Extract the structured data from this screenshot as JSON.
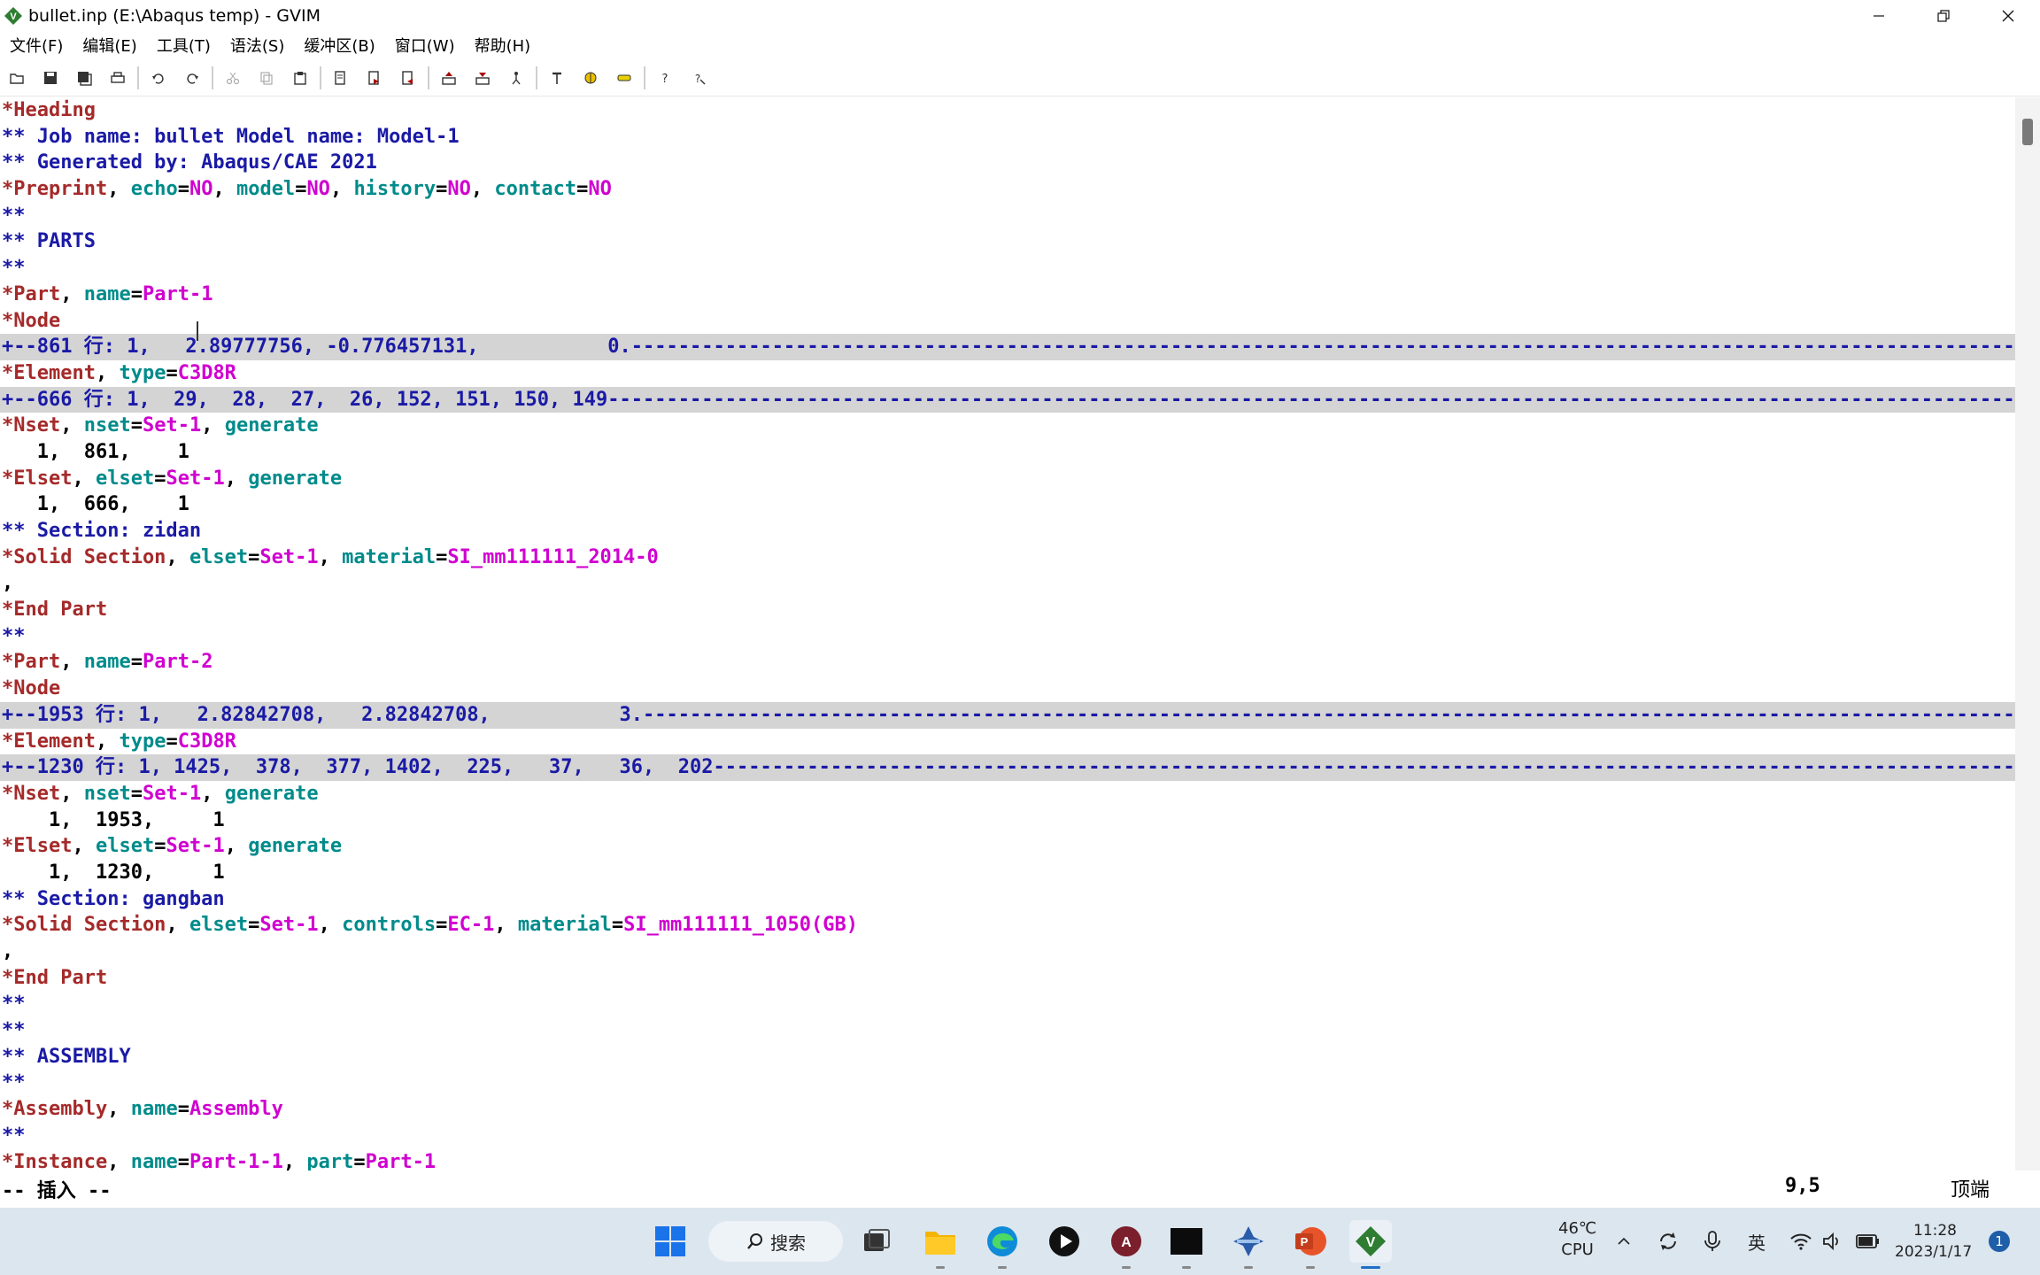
{
  "window": {
    "title": "bullet.inp (E:\\Abaqus temp) - GVIM"
  },
  "menu": [
    "文件(F)",
    "编辑(E)",
    "工具(T)",
    "语法(S)",
    "缓冲区(B)",
    "窗口(W)",
    "帮助(H)"
  ],
  "toolbar": {
    "groups": [
      [
        "open-icon",
        "save-icon",
        "save-all-icon",
        "print-icon"
      ],
      [
        "undo-icon",
        "redo-icon"
      ],
      [
        "cut-icon",
        "copy-icon",
        "paste-icon"
      ],
      [
        "find-replace-icon",
        "find-next-icon",
        "find-prev-icon"
      ],
      [
        "load-session-icon",
        "save-session-icon",
        "run-script-icon"
      ],
      [
        "make-icon",
        "shell-icon",
        "tags-icon"
      ],
      [
        "help-icon",
        "find-help-icon"
      ]
    ]
  },
  "editor": {
    "lines": [
      [
        {
          "t": "*Heading",
          "c": "kw"
        }
      ],
      [
        {
          "t": "** Job name: bullet Model name: Model-1",
          "c": "cmt"
        }
      ],
      [
        {
          "t": "** Generated by: Abaqus/CAE 2021",
          "c": "cmt"
        }
      ],
      [
        {
          "t": "*Preprint",
          "c": "kw"
        },
        {
          "t": ", ",
          "c": "plain"
        },
        {
          "t": "echo",
          "c": "attr"
        },
        {
          "t": "=",
          "c": "plain"
        },
        {
          "t": "NO",
          "c": "val"
        },
        {
          "t": ", ",
          "c": "plain"
        },
        {
          "t": "model",
          "c": "attr"
        },
        {
          "t": "=",
          "c": "plain"
        },
        {
          "t": "NO",
          "c": "val"
        },
        {
          "t": ", ",
          "c": "plain"
        },
        {
          "t": "history",
          "c": "attr"
        },
        {
          "t": "=",
          "c": "plain"
        },
        {
          "t": "NO",
          "c": "val"
        },
        {
          "t": ", ",
          "c": "plain"
        },
        {
          "t": "contact",
          "c": "attr"
        },
        {
          "t": "=",
          "c": "plain"
        },
        {
          "t": "NO",
          "c": "val"
        }
      ],
      [
        {
          "t": "**",
          "c": "cmt"
        }
      ],
      [
        {
          "t": "** PARTS",
          "c": "cmt"
        }
      ],
      [
        {
          "t": "**",
          "c": "cmt"
        }
      ],
      [
        {
          "t": "*Part",
          "c": "kw"
        },
        {
          "t": ", ",
          "c": "plain"
        },
        {
          "t": "name",
          "c": "attr"
        },
        {
          "t": "=",
          "c": "plain"
        },
        {
          "t": "Part-1",
          "c": "val"
        }
      ],
      [
        {
          "t": "*Node",
          "c": "kw"
        }
      ],
      {
        "fold": "+--861 行: 1,   2.89777756, -0.776457131,           0.------------------------------------------------------------------------------------------------------------------------------------------"
      },
      [
        {
          "t": "*Element",
          "c": "kw"
        },
        {
          "t": ", ",
          "c": "plain"
        },
        {
          "t": "type",
          "c": "attr"
        },
        {
          "t": "=",
          "c": "plain"
        },
        {
          "t": "C3D8R",
          "c": "val"
        }
      ],
      {
        "fold": "+--666 行: 1,  29,  28,  27,  26, 152, 151, 150, 149--------------------------------------------------------------------------------------------------------------------------------------------------"
      },
      [
        {
          "t": "*Nset",
          "c": "kw"
        },
        {
          "t": ", ",
          "c": "plain"
        },
        {
          "t": "nset",
          "c": "attr"
        },
        {
          "t": "=",
          "c": "plain"
        },
        {
          "t": "Set-1",
          "c": "val"
        },
        {
          "t": ", ",
          "c": "plain"
        },
        {
          "t": "generate",
          "c": "attr"
        }
      ],
      [
        {
          "t": "   1,  861,    1",
          "c": "plain"
        }
      ],
      [
        {
          "t": "*Elset",
          "c": "kw"
        },
        {
          "t": ", ",
          "c": "plain"
        },
        {
          "t": "elset",
          "c": "attr"
        },
        {
          "t": "=",
          "c": "plain"
        },
        {
          "t": "Set-1",
          "c": "val"
        },
        {
          "t": ", ",
          "c": "plain"
        },
        {
          "t": "generate",
          "c": "attr"
        }
      ],
      [
        {
          "t": "   1,  666,    1",
          "c": "plain"
        }
      ],
      [
        {
          "t": "** Section: zidan",
          "c": "cmt"
        }
      ],
      [
        {
          "t": "*Solid Section",
          "c": "kw"
        },
        {
          "t": ", ",
          "c": "plain"
        },
        {
          "t": "elset",
          "c": "attr"
        },
        {
          "t": "=",
          "c": "plain"
        },
        {
          "t": "Set-1",
          "c": "val"
        },
        {
          "t": ", ",
          "c": "plain"
        },
        {
          "t": "material",
          "c": "attr"
        },
        {
          "t": "=",
          "c": "plain"
        },
        {
          "t": "SI_mm111111_2014-0",
          "c": "val"
        }
      ],
      [
        {
          "t": ",",
          "c": "plain"
        }
      ],
      [
        {
          "t": "*End Part",
          "c": "kw"
        }
      ],
      [
        {
          "t": "**",
          "c": "cmt"
        }
      ],
      [
        {
          "t": "*Part",
          "c": "kw"
        },
        {
          "t": ", ",
          "c": "plain"
        },
        {
          "t": "name",
          "c": "attr"
        },
        {
          "t": "=",
          "c": "plain"
        },
        {
          "t": "Part-2",
          "c": "val"
        }
      ],
      [
        {
          "t": "*Node",
          "c": "kw"
        }
      ],
      {
        "fold": "+--1953 行: 1,   2.82842708,   2.82842708,           3.----------------------------------------------------------------------------------------------------------------------------------------"
      },
      [
        {
          "t": "*Element",
          "c": "kw"
        },
        {
          "t": ", ",
          "c": "plain"
        },
        {
          "t": "type",
          "c": "attr"
        },
        {
          "t": "=",
          "c": "plain"
        },
        {
          "t": "C3D8R",
          "c": "val"
        }
      ],
      {
        "fold": "+--1230 行: 1, 1425,  378,  377, 1402,  225,   37,   36,  202-------------------------------------------------------------------------------------------------------------------------------------------"
      },
      [
        {
          "t": "*Nset",
          "c": "kw"
        },
        {
          "t": ", ",
          "c": "plain"
        },
        {
          "t": "nset",
          "c": "attr"
        },
        {
          "t": "=",
          "c": "plain"
        },
        {
          "t": "Set-1",
          "c": "val"
        },
        {
          "t": ", ",
          "c": "plain"
        },
        {
          "t": "generate",
          "c": "attr"
        }
      ],
      [
        {
          "t": "    1,  1953,     1",
          "c": "plain"
        }
      ],
      [
        {
          "t": "*Elset",
          "c": "kw"
        },
        {
          "t": ", ",
          "c": "plain"
        },
        {
          "t": "elset",
          "c": "attr"
        },
        {
          "t": "=",
          "c": "plain"
        },
        {
          "t": "Set-1",
          "c": "val"
        },
        {
          "t": ", ",
          "c": "plain"
        },
        {
          "t": "generate",
          "c": "attr"
        }
      ],
      [
        {
          "t": "    1,  1230,     1",
          "c": "plain"
        }
      ],
      [
        {
          "t": "** Section: gangban",
          "c": "cmt"
        }
      ],
      [
        {
          "t": "*Solid Section",
          "c": "kw"
        },
        {
          "t": ", ",
          "c": "plain"
        },
        {
          "t": "elset",
          "c": "attr"
        },
        {
          "t": "=",
          "c": "plain"
        },
        {
          "t": "Set-1",
          "c": "val"
        },
        {
          "t": ", ",
          "c": "plain"
        },
        {
          "t": "controls",
          "c": "attr"
        },
        {
          "t": "=",
          "c": "plain"
        },
        {
          "t": "EC-1",
          "c": "val"
        },
        {
          "t": ", ",
          "c": "plain"
        },
        {
          "t": "material",
          "c": "attr"
        },
        {
          "t": "=",
          "c": "plain"
        },
        {
          "t": "SI_mm111111_1050(GB)",
          "c": "val"
        }
      ],
      [
        {
          "t": ",",
          "c": "plain"
        }
      ],
      [
        {
          "t": "*End Part",
          "c": "kw"
        }
      ],
      [
        {
          "t": "**",
          "c": "cmt"
        }
      ],
      [
        {
          "t": "**",
          "c": "cmt"
        }
      ],
      [
        {
          "t": "** ASSEMBLY",
          "c": "cmt"
        }
      ],
      [
        {
          "t": "**",
          "c": "cmt"
        }
      ],
      [
        {
          "t": "*Assembly",
          "c": "kw"
        },
        {
          "t": ", ",
          "c": "plain"
        },
        {
          "t": "name",
          "c": "attr"
        },
        {
          "t": "=",
          "c": "plain"
        },
        {
          "t": "Assembly",
          "c": "val"
        }
      ],
      [
        {
          "t": "**",
          "c": "cmt"
        }
      ],
      [
        {
          "t": "*Instance",
          "c": "kw"
        },
        {
          "t": ", ",
          "c": "plain"
        },
        {
          "t": "name",
          "c": "attr"
        },
        {
          "t": "=",
          "c": "plain"
        },
        {
          "t": "Part-1-1",
          "c": "val"
        },
        {
          "t": ", ",
          "c": "plain"
        },
        {
          "t": "part",
          "c": "attr"
        },
        {
          "t": "=",
          "c": "plain"
        },
        {
          "t": "Part-1",
          "c": "val"
        }
      ]
    ]
  },
  "statusline": {
    "mode": "-- 插入 --",
    "position": "9,5",
    "scroll": "顶端"
  },
  "taskbar": {
    "search_label": "搜索",
    "weather_temp": "46℃",
    "weather_label": "CPU",
    "ime": "英",
    "time": "11:28",
    "date": "2023/1/17",
    "notification_count": "1"
  },
  "colors": {
    "keyword": "#a52a2a",
    "attribute": "#008b8b",
    "value": "#d000d0",
    "comment": "#1a1aa6",
    "fold_bg": "#d4d4d4"
  }
}
